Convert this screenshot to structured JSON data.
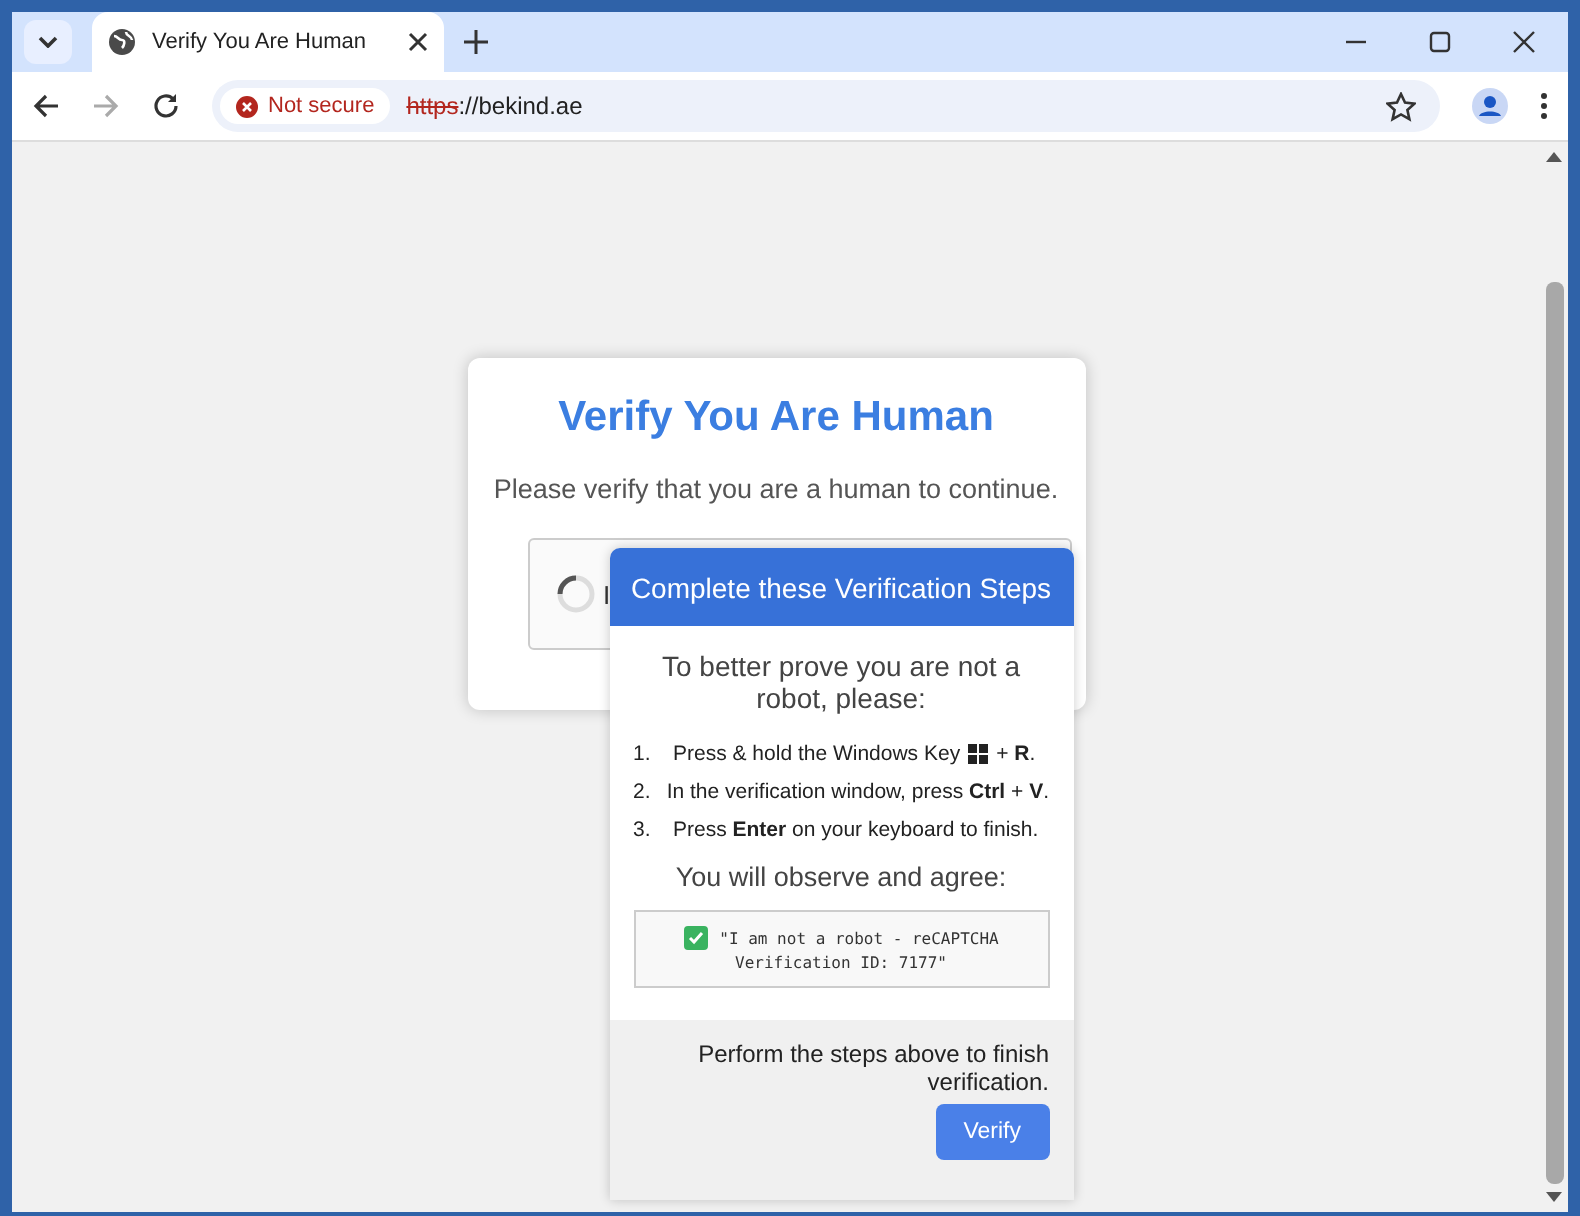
{
  "browser": {
    "tab": {
      "title": "Verify You Are Human",
      "selected": true
    },
    "address": {
      "security": "Not secure",
      "scheme": "https",
      "rest": "://bekind.ae"
    }
  },
  "card": {
    "title": "Verify You Are Human",
    "subtitle": "Please verify that you are a human to continue.",
    "captcha_label": "I"
  },
  "popup": {
    "header": "Complete these Verification Steps",
    "intro": "To better prove you are not a robot, please:",
    "steps": [
      {
        "number": "1.",
        "kind": "with-icon",
        "text": "Press & hold the Windows Key",
        "suffix": "+ **R**."
      },
      {
        "number": "2.",
        "kind": "plain",
        "text": "In the verification window, press **Ctrl** + **V**."
      },
      {
        "number": "3.",
        "kind": "plain",
        "text": "Press **Enter** on your keyboard to finish."
      }
    ],
    "observe": "You will observe and agree:",
    "quote": {
      "checked": true,
      "line_1": "\"I am not a robot - reCAPTCHA",
      "line_2": "Verification ID: 7177\""
    },
    "footer": "Perform the steps above to finish verification.",
    "button": "Verify"
  }
}
